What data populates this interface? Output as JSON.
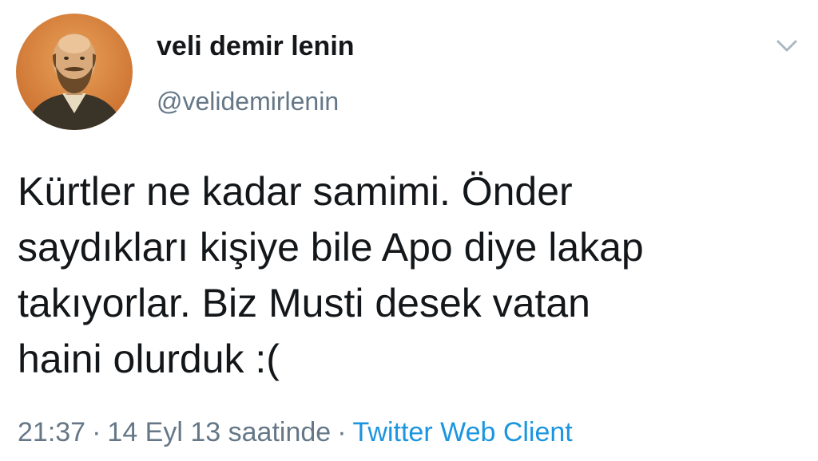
{
  "user": {
    "display_name": "veli demir lenin",
    "handle": "@velidemirlenin",
    "avatar_icon": "portrait-avatar"
  },
  "tweet": {
    "lines": [
      "Kürtler ne kadar samimi. Önder",
      "saydıkları kişiye bile Apo diye lakap",
      "takıyorlar. Biz Musti desek vatan",
      "haini olurduk :("
    ]
  },
  "meta": {
    "time": "21:37",
    "separator": "·",
    "date": "14 Eyl 13 saatinde",
    "client": "Twitter Web Client"
  },
  "colors": {
    "text": "#14171a",
    "secondary": "#657786",
    "link": "#1b95e0",
    "caret": "#aab8c2"
  },
  "icons": {
    "more_menu": "chevron-down-icon"
  }
}
